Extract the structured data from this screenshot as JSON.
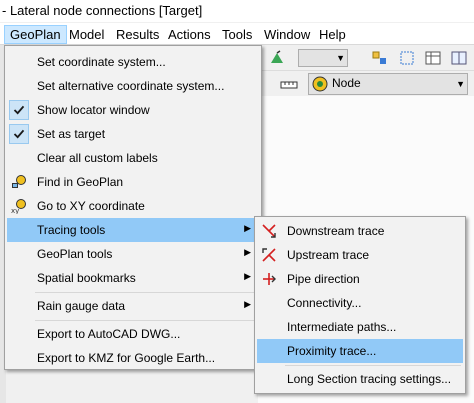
{
  "window": {
    "title": "- Lateral node connections [Target]"
  },
  "menubar": {
    "items": [
      {
        "label": "GeoPlan"
      },
      {
        "label": "Model"
      },
      {
        "label": "Results"
      },
      {
        "label": "Actions"
      },
      {
        "label": "Tools"
      },
      {
        "label": "Window"
      },
      {
        "label": "Help"
      }
    ]
  },
  "toolbar": {
    "layer_combo_value": "Node"
  },
  "geoplan_menu": {
    "items": [
      {
        "label": "Set coordinate system..."
      },
      {
        "label": "Set alternative coordinate system..."
      },
      {
        "label": "Show locator window",
        "checked": true
      },
      {
        "label": "Set as target",
        "checked": true
      },
      {
        "label": "Clear all custom labels"
      },
      {
        "label": "Find in GeoPlan",
        "icon": "find-in-geoplan-icon"
      },
      {
        "label": "Go to XY coordinate",
        "icon": "xy-coordinate-icon"
      },
      {
        "label": "Tracing tools",
        "has_submenu": true,
        "highlighted": true
      },
      {
        "label": "GeoPlan tools",
        "has_submenu": true
      },
      {
        "label": "Spatial bookmarks",
        "has_submenu": true
      },
      {
        "label": "Rain gauge data",
        "has_submenu": true
      },
      {
        "label": "Export to AutoCAD DWG..."
      },
      {
        "label": "Export to KMZ for Google Earth..."
      }
    ]
  },
  "tracing_submenu": {
    "items": [
      {
        "label": "Downstream trace",
        "icon": "downstream-trace-icon"
      },
      {
        "label": "Upstream trace",
        "icon": "upstream-trace-icon"
      },
      {
        "label": "Pipe direction",
        "icon": "pipe-direction-icon"
      },
      {
        "label": "Connectivity..."
      },
      {
        "label": "Intermediate paths..."
      },
      {
        "label": "Proximity trace...",
        "highlighted": true
      },
      {
        "label": "Long Section tracing settings..."
      }
    ]
  },
  "colors": {
    "menu_highlight": "#91c9f7",
    "menubar_active": "#cce8ff",
    "check_bg": "#cce4f7",
    "trace_red": "#d42020"
  }
}
